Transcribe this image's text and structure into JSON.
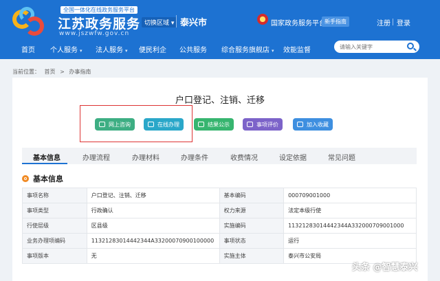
{
  "header": {
    "slogan": "全国一体化在线政务服务平台",
    "site_title": "江苏政务服务",
    "site_url": "www.jszwfw.gov.cn",
    "region_switch": "切换区域",
    "region_caret": "▾",
    "region_name": "泰兴市",
    "gov_platform": "国家政务服务平台",
    "guide": "新手指南",
    "register": "注册",
    "login": "登录"
  },
  "nav": {
    "items": [
      {
        "label": "首页",
        "caret": ""
      },
      {
        "label": "个人服务",
        "caret": "▾"
      },
      {
        "label": "法人服务",
        "caret": "▾"
      },
      {
        "label": "便民利企",
        "caret": ""
      },
      {
        "label": "公共服务",
        "caret": ""
      },
      {
        "label": "综合服务旗舰店",
        "caret": "▾"
      },
      {
        "label": "效能监督",
        "caret": ""
      }
    ],
    "search_placeholder": "请输入关键字"
  },
  "breadcrumb": {
    "prefix": "当前位置：",
    "items": [
      "首页",
      ">",
      "办事指南"
    ]
  },
  "page_title": "户口登记、注销、迁移",
  "actions": {
    "consult": "网上咨询",
    "online": "在线办理",
    "result": "结果公示",
    "eval": "事项评价",
    "fav": "加入收藏"
  },
  "tabs": [
    "基本信息",
    "办理流程",
    "办理材料",
    "办理条件",
    "收费情况",
    "设定依据",
    "常见问题"
  ],
  "section_title": "基本信息",
  "info_rows": [
    [
      "事项名称",
      "户口登记、注销、迁移",
      "基本编码",
      "000709001000"
    ],
    [
      "事项类型",
      "行政确认",
      "权力来源",
      "法定本级行使"
    ],
    [
      "行使层级",
      "区县级",
      "实施编码",
      "11321283014442344A332000709001000"
    ],
    [
      "业务办理项编码",
      "11321283014442344A33200070900100000",
      "事项状态",
      "运行"
    ],
    [
      "事项版本",
      "无",
      "实施主体",
      "泰兴市公安局"
    ]
  ],
  "watermark": "头条 @智慧泰兴",
  "colors": {
    "header_blue": "#1d72d2",
    "highlight_red": "#d33"
  }
}
